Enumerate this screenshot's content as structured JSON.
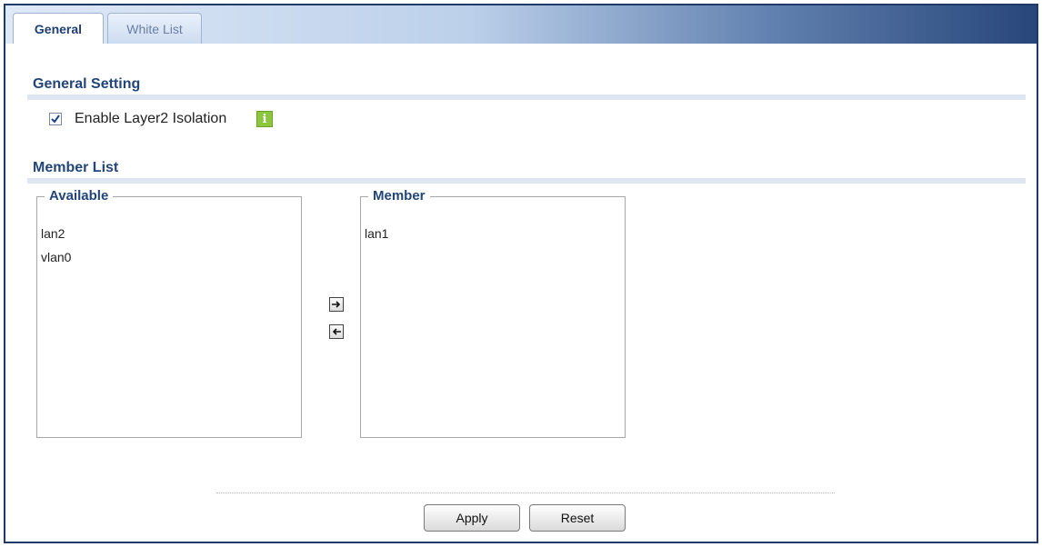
{
  "tabs": [
    {
      "label": "General",
      "active": true
    },
    {
      "label": "White List",
      "active": false
    }
  ],
  "general_setting": {
    "title": "General Setting",
    "enable_layer2_isolation": {
      "label": "Enable Layer2 Isolation",
      "checked": true
    },
    "info_icon": "info-icon"
  },
  "member_list": {
    "title": "Member List",
    "available": {
      "legend": "Available",
      "items": [
        "lan2",
        "vlan0"
      ]
    },
    "member": {
      "legend": "Member",
      "items": [
        "lan1"
      ]
    },
    "move_right_icon": "arrow-right-icon",
    "move_left_icon": "arrow-left-icon"
  },
  "buttons": {
    "apply": "Apply",
    "reset": "Reset"
  },
  "colors": {
    "title": "#22457a",
    "border": "#1f3a66",
    "info": "#8cc63f"
  }
}
